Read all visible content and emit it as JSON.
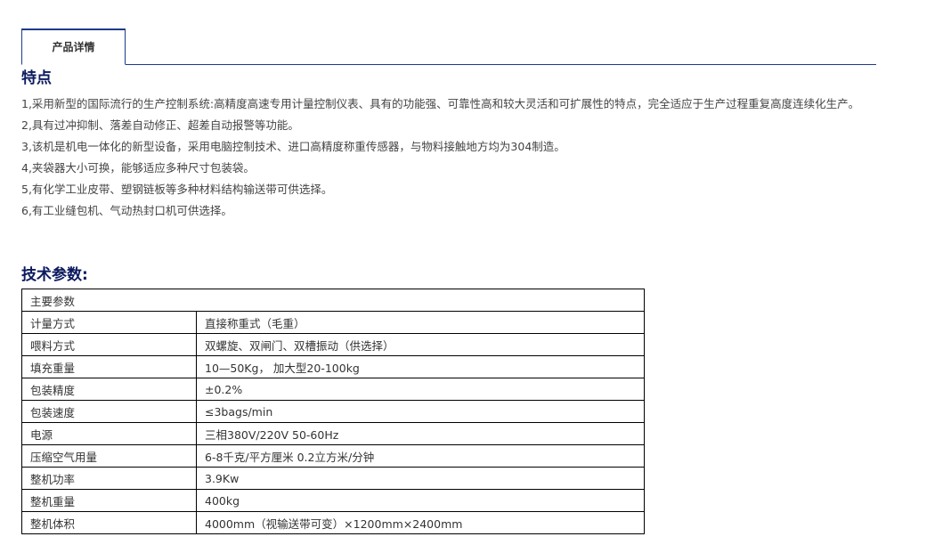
{
  "tab": {
    "label": "产品详情"
  },
  "features": {
    "title": "特点",
    "items": [
      "1,采用新型的国际流行的生产控制系统:高精度高速专用计量控制仪表、具有的功能强、可靠性高和较大灵活和可扩展性的特点，完全适应于生产过程重复高度连续化生产。",
      "2,具有过冲抑制、落差自动修正、超差自动报警等功能。",
      "3,该机是机电一体化的新型设备，采用电脑控制技术、进口高精度称重传感器，与物料接触地方均为304制造。",
      "4,夹袋器大小可换，能够适应多种尺寸包装袋。",
      "5,有化学工业皮带、塑钢链板等多种材料结构输送带可供选择。",
      "6,有工业缝包机、气动热封口机可供选择。"
    ]
  },
  "specs": {
    "title": "技术参数:",
    "header": "主要参数",
    "rows": [
      {
        "label": "计量方式",
        "value": "直接称重式（毛重）"
      },
      {
        "label": "喂料方式",
        "value": "双螺旋、双闸门、双槽振动（供选择）"
      },
      {
        "label": "填充重量",
        "value": "10—50Kg， 加大型20-100kg"
      },
      {
        "label": "包装精度",
        "value": "±0.2%"
      },
      {
        "label": "包装速度",
        "value": "≤3bags/min"
      },
      {
        "label": "电源",
        "value": "三相380V/220V 50-60Hz"
      },
      {
        "label": "压缩空气用量",
        "value": "6-8千克/平方厘米 0.2立方米/分钟"
      },
      {
        "label": "整机功率",
        "value": "3.9Kw"
      },
      {
        "label": "整机重量",
        "value": "400kg"
      },
      {
        "label": "整机体积",
        "value": "4000mm（视输送带可变）×1200mm×2400mm"
      }
    ]
  }
}
